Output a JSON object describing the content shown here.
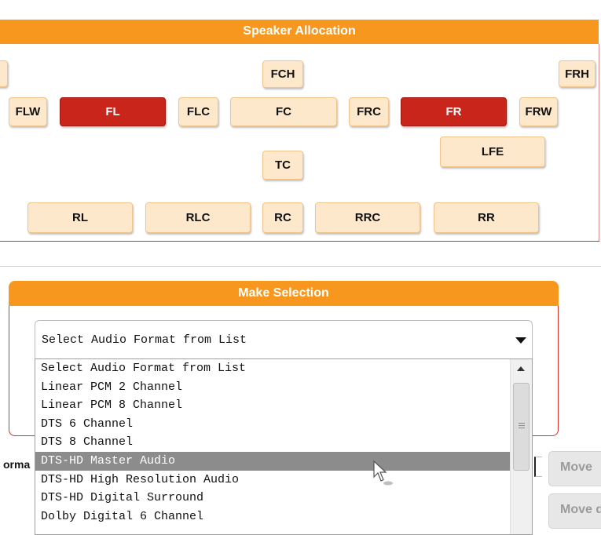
{
  "speaker_allocation": {
    "title": "Speaker Allocation",
    "speakers": {
      "FCH": "FCH",
      "FRH": "FRH",
      "FLW": "FLW",
      "FL": "FL",
      "FLC": "FLC",
      "FC": "FC",
      "FRC": "FRC",
      "FR": "FR",
      "FRW": "FRW",
      "LFE": "LFE",
      "TC": "TC",
      "RL": "RL",
      "RLC": "RLC",
      "RC": "RC",
      "RRC": "RRC",
      "RR": "RR"
    },
    "active": [
      "FL",
      "FR"
    ],
    "colors": {
      "active": "#c9251b",
      "inactive": "#fde8cc",
      "accent": "#f7971e"
    }
  },
  "make_selection": {
    "title": "Make Selection",
    "select_value": "Select Audio Format from List",
    "options": [
      "Select Audio Format from List",
      "Linear PCM 2 Channel",
      "Linear PCM 8 Channel",
      "DTS 6 Channel",
      "DTS 8 Channel",
      "DTS-HD Master Audio",
      "DTS-HD High Resolution Audio",
      "DTS-HD Digital Surround",
      "Dolby Digital 6 Channel"
    ],
    "highlighted_option": "DTS-HD Master Audio"
  },
  "lower": {
    "partial_left_label": "orma",
    "buttons": {
      "move_up": "Move",
      "move_down": "Move d"
    }
  }
}
